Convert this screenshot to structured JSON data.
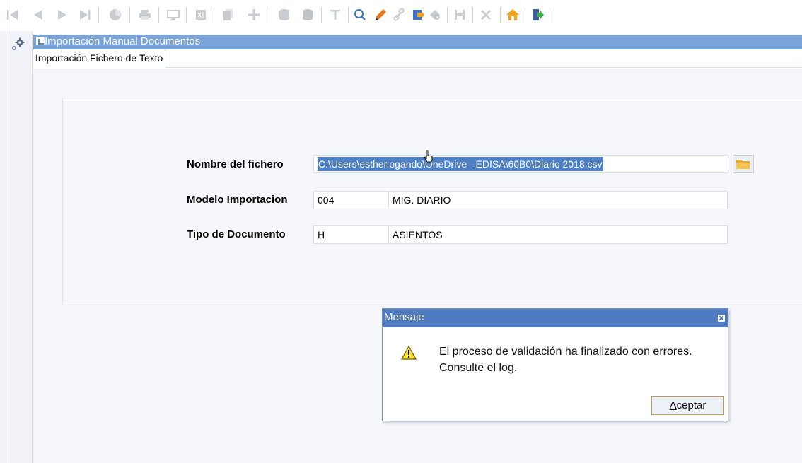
{
  "toolbar": {
    "buttons": [
      {
        "name": "first-record-icon",
        "enabled": false
      },
      {
        "name": "previous-record-icon",
        "enabled": false
      },
      {
        "name": "next-record-icon",
        "enabled": false
      },
      {
        "name": "last-record-icon",
        "enabled": false
      },
      {
        "name": "chart-icon",
        "enabled": false
      },
      {
        "name": "print-icon",
        "enabled": false
      },
      {
        "name": "screen-icon",
        "enabled": false
      },
      {
        "name": "excel-icon",
        "enabled": false
      },
      {
        "name": "copy-icon",
        "enabled": false
      },
      {
        "name": "add-icon",
        "enabled": false
      },
      {
        "name": "database-icon",
        "enabled": false
      },
      {
        "name": "database-save-icon",
        "enabled": false
      },
      {
        "name": "filter-icon",
        "enabled": false
      },
      {
        "name": "search-icon",
        "enabled": true
      },
      {
        "name": "edit-pencil-icon",
        "enabled": true
      },
      {
        "name": "link-icon",
        "enabled": false
      },
      {
        "name": "export-icon",
        "enabled": true
      },
      {
        "name": "find-record-icon",
        "enabled": false
      },
      {
        "name": "save-icon",
        "enabled": false
      },
      {
        "name": "delete-icon",
        "enabled": false
      },
      {
        "name": "home-icon",
        "enabled": true
      },
      {
        "name": "exit-icon",
        "enabled": true
      }
    ]
  },
  "window": {
    "title": "Importación Manual Documentos",
    "tabs": [
      {
        "label": "Importación Fichero de Texto"
      }
    ]
  },
  "form": {
    "file_label": "Nombre del fichero",
    "file_value": "C:\\Users\\esther.ogando\\OneDrive - EDISA\\60B0\\Diario 2018.csv",
    "model_label": "Modelo Importacion",
    "model_code": "004",
    "model_desc": "MIG. DIARIO",
    "doctype_label": "Tipo de Documento",
    "doctype_code": "H",
    "doctype_desc": "ASIENTOS"
  },
  "dialog": {
    "title": "Mensaje",
    "line1": "El proceso de validación ha finalizado con errores.",
    "line2": "Consulte el log.",
    "ok_first": "A",
    "ok_rest": "ceptar"
  },
  "colors": {
    "title_bar": "#7aa3d7",
    "dialog_title": "#4f7cc1",
    "selection": "#4d7fc4",
    "icon_disabled": "#c9ccd1",
    "icon_blue": "#3f73c4"
  }
}
